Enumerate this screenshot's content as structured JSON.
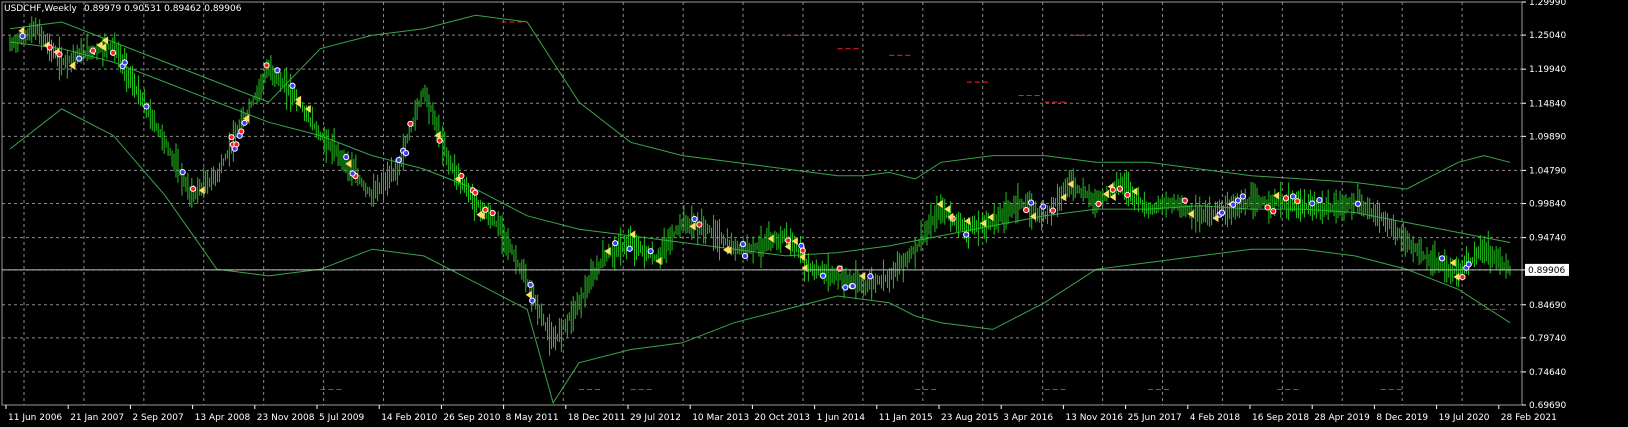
{
  "header": {
    "symbol": "USDCHF,Weekly",
    "ohlc": "0.89979 0.90531 0.89462 0.89906"
  },
  "current_price_label": "0.89906",
  "colors": {
    "background": "#000000",
    "grid": "#8a8a8a",
    "candle": "#22c51e",
    "bollinger": "#3aa54a",
    "marker_red": "#ff1a1a",
    "marker_blue": "#3a3aff",
    "marker_yellow": "#ffdd66",
    "text": "#ffffff"
  },
  "chart_data": {
    "type": "line",
    "title": "USDCHF,Weekly",
    "ylim": [
      0.6969,
      1.2999
    ],
    "y_ticks": [
      "1.29990",
      "1.25040",
      "1.19940",
      "1.14840",
      "1.09890",
      "1.04790",
      "0.99840",
      "0.94740",
      "0.89906",
      "0.84690",
      "0.79740",
      "0.74640",
      "0.69690"
    ],
    "x_tick_labels": [
      "11 Jun 2006",
      "21 Jan 2007",
      "2 Sep 2007",
      "13 Apr 2008",
      "23 Nov 2008",
      "5 Jul 2009",
      "14 Feb 2010",
      "26 Sep 2010",
      "8 May 2011",
      "18 Dec 2011",
      "29 Jul 2012",
      "10 Mar 2013",
      "20 Oct 2013",
      "1 Jun 2014",
      "11 Jan 2015",
      "23 Aug 2015",
      "3 Apr 2016",
      "13 Nov 2016",
      "25 Jun 2017",
      "4 Feb 2018",
      "16 Sep 2018",
      "28 Apr 2019",
      "8 Dec 2019",
      "19 Jul 2020",
      "28 Feb 2021"
    ],
    "current_price": 0.89906,
    "series": [
      {
        "type": "price",
        "points": [
          [
            0,
            1.235
          ],
          [
            1,
            1.26
          ],
          [
            2,
            1.21
          ],
          [
            3,
            1.225
          ],
          [
            4,
            1.235
          ],
          [
            5,
            1.16
          ],
          [
            6,
            1.09
          ],
          [
            7,
            1.01
          ],
          [
            8,
            1.04
          ],
          [
            9,
            1.12
          ],
          [
            10,
            1.2
          ],
          [
            11,
            1.16
          ],
          [
            12,
            1.1
          ],
          [
            13,
            1.06
          ],
          [
            14,
            1.01
          ],
          [
            15,
            1.05
          ],
          [
            16,
            1.17
          ],
          [
            17,
            1.06
          ],
          [
            18,
            1.0
          ],
          [
            19,
            0.96
          ],
          [
            20,
            0.88
          ],
          [
            21,
            0.79
          ],
          [
            22,
            0.85
          ],
          [
            23,
            0.92
          ],
          [
            24,
            0.94
          ],
          [
            25,
            0.915
          ],
          [
            26,
            0.97
          ],
          [
            27,
            0.96
          ],
          [
            28,
            0.93
          ],
          [
            29,
            0.935
          ],
          [
            30,
            0.95
          ],
          [
            31,
            0.9
          ],
          [
            32,
            0.89
          ],
          [
            33,
            0.875
          ],
          [
            34,
            0.89
          ],
          [
            35,
            0.93
          ],
          [
            36,
            0.99
          ],
          [
            37,
            0.96
          ],
          [
            38,
            0.97
          ],
          [
            39,
            1.0
          ],
          [
            40,
            0.98
          ],
          [
            41,
            1.03
          ],
          [
            42,
            1.0
          ],
          [
            43,
            1.03
          ],
          [
            44,
            0.99
          ],
          [
            45,
            1.0
          ],
          [
            46,
            0.98
          ],
          [
            47,
            0.99
          ],
          [
            48,
            1.0
          ],
          [
            49,
            1.0
          ],
          [
            50,
            0.995
          ],
          [
            51,
            0.99
          ],
          [
            52,
            1.0
          ],
          [
            53,
            0.98
          ],
          [
            54,
            0.94
          ],
          [
            55,
            0.91
          ],
          [
            56,
            0.895
          ],
          [
            57,
            0.93
          ],
          [
            58,
            0.9
          ]
        ]
      },
      {
        "type": "bollinger-mid",
        "points": [
          [
            0,
            1.24
          ],
          [
            2,
            1.23
          ],
          [
            4,
            1.21
          ],
          [
            6,
            1.18
          ],
          [
            8,
            1.15
          ],
          [
            10,
            1.12
          ],
          [
            12,
            1.1
          ],
          [
            14,
            1.07
          ],
          [
            16,
            1.05
          ],
          [
            18,
            1.02
          ],
          [
            20,
            0.98
          ],
          [
            22,
            0.96
          ],
          [
            24,
            0.95
          ],
          [
            26,
            0.94
          ],
          [
            28,
            0.93
          ],
          [
            30,
            0.92
          ],
          [
            32,
            0.925
          ],
          [
            34,
            0.935
          ],
          [
            36,
            0.95
          ],
          [
            38,
            0.965
          ],
          [
            40,
            0.98
          ],
          [
            42,
            0.99
          ],
          [
            44,
            0.99
          ],
          [
            46,
            0.995
          ],
          [
            48,
            0.99
          ],
          [
            50,
            0.99
          ],
          [
            52,
            0.985
          ],
          [
            54,
            0.97
          ],
          [
            56,
            0.955
          ],
          [
            58,
            0.94
          ]
        ]
      },
      {
        "type": "bollinger-upper",
        "points": [
          [
            0,
            1.26
          ],
          [
            2,
            1.27
          ],
          [
            4,
            1.24
          ],
          [
            6,
            1.21
          ],
          [
            8,
            1.18
          ],
          [
            10,
            1.15
          ],
          [
            12,
            1.23
          ],
          [
            14,
            1.25
          ],
          [
            16,
            1.26
          ],
          [
            18,
            1.28
          ],
          [
            20,
            1.27
          ],
          [
            22,
            1.15
          ],
          [
            24,
            1.09
          ],
          [
            26,
            1.07
          ],
          [
            28,
            1.06
          ],
          [
            30,
            1.05
          ],
          [
            32,
            1.04
          ],
          [
            33,
            1.04
          ],
          [
            34,
            1.045
          ],
          [
            35,
            1.035
          ],
          [
            36,
            1.06
          ],
          [
            38,
            1.07
          ],
          [
            40,
            1.07
          ],
          [
            42,
            1.06
          ],
          [
            44,
            1.06
          ],
          [
            46,
            1.05
          ],
          [
            48,
            1.04
          ],
          [
            50,
            1.035
          ],
          [
            52,
            1.03
          ],
          [
            54,
            1.02
          ],
          [
            55,
            1.04
          ],
          [
            56,
            1.06
          ],
          [
            57,
            1.07
          ],
          [
            58,
            1.06
          ]
        ]
      },
      {
        "type": "bollinger-lower",
        "points": [
          [
            0,
            1.08
          ],
          [
            2,
            1.14
          ],
          [
            4,
            1.1
          ],
          [
            6,
            1.01
          ],
          [
            8,
            0.9
          ],
          [
            10,
            0.89
          ],
          [
            12,
            0.9
          ],
          [
            14,
            0.93
          ],
          [
            16,
            0.92
          ],
          [
            18,
            0.88
          ],
          [
            20,
            0.84
          ],
          [
            21,
            0.7
          ],
          [
            22,
            0.76
          ],
          [
            24,
            0.78
          ],
          [
            26,
            0.79
          ],
          [
            28,
            0.82
          ],
          [
            30,
            0.84
          ],
          [
            32,
            0.86
          ],
          [
            34,
            0.85
          ],
          [
            35,
            0.83
          ],
          [
            36,
            0.82
          ],
          [
            38,
            0.81
          ],
          [
            40,
            0.85
          ],
          [
            42,
            0.9
          ],
          [
            44,
            0.91
          ],
          [
            46,
            0.92
          ],
          [
            48,
            0.93
          ],
          [
            50,
            0.93
          ],
          [
            52,
            0.92
          ],
          [
            54,
            0.9
          ],
          [
            56,
            0.87
          ],
          [
            58,
            0.82
          ]
        ]
      }
    ]
  }
}
